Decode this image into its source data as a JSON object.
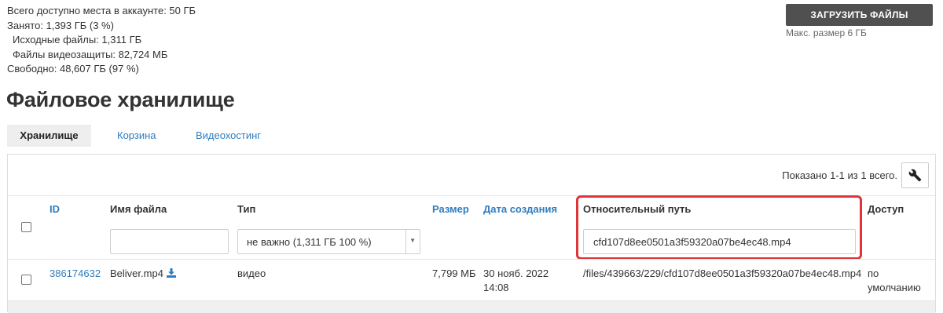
{
  "quota": {
    "total": "Всего доступно места в аккаунте: 50 ГБ",
    "used": "Занято: 1,393 ГБ (3 %)",
    "source_files": "Исходные файлы: 1,311 ГБ",
    "protection_files": "Файлы видеозащиты: 82,724 МБ",
    "free": "Свободно: 48,607 ГБ (97 %)"
  },
  "upload": {
    "button_label": "ЗАГРУЗИТЬ ФАЙЛЫ",
    "hint": "Макс. размер 6 ГБ"
  },
  "page_title": "Файловое хранилище",
  "tabs": [
    {
      "label": "Хранилище",
      "active": true
    },
    {
      "label": "Корзина",
      "active": false
    },
    {
      "label": "Видеохостинг",
      "active": false
    }
  ],
  "table": {
    "shown_count": "Показано 1-1 из 1 всего.",
    "settings_icon": "wrench-icon",
    "columns": {
      "id": "ID",
      "name": "Имя файла",
      "type": "Тип",
      "size": "Размер",
      "created": "Дата создания",
      "path": "Относительный путь",
      "access": "Доступ"
    },
    "filters": {
      "name_value": "",
      "type_value": "не важно (1,311 ГБ 100 %)",
      "path_value": "cfd107d8ee0501a3f59320a07be4ec48.mp4"
    },
    "rows": [
      {
        "id": "386174632",
        "name": "Beliver.mp4",
        "download_icon": "download-icon",
        "type": "видео",
        "size": "7,799 МБ",
        "created_date": "30 нояб. 2022",
        "created_time": "14:08",
        "path": "/files/439663/229/cfd107d8ee0501a3f59320a07be4ec48.mp4",
        "access_line1": "по",
        "access_line2": "умолчанию"
      }
    ]
  },
  "colors": {
    "link": "#2f7dbf",
    "button_bg": "#505050",
    "highlight": "#e0343a"
  }
}
